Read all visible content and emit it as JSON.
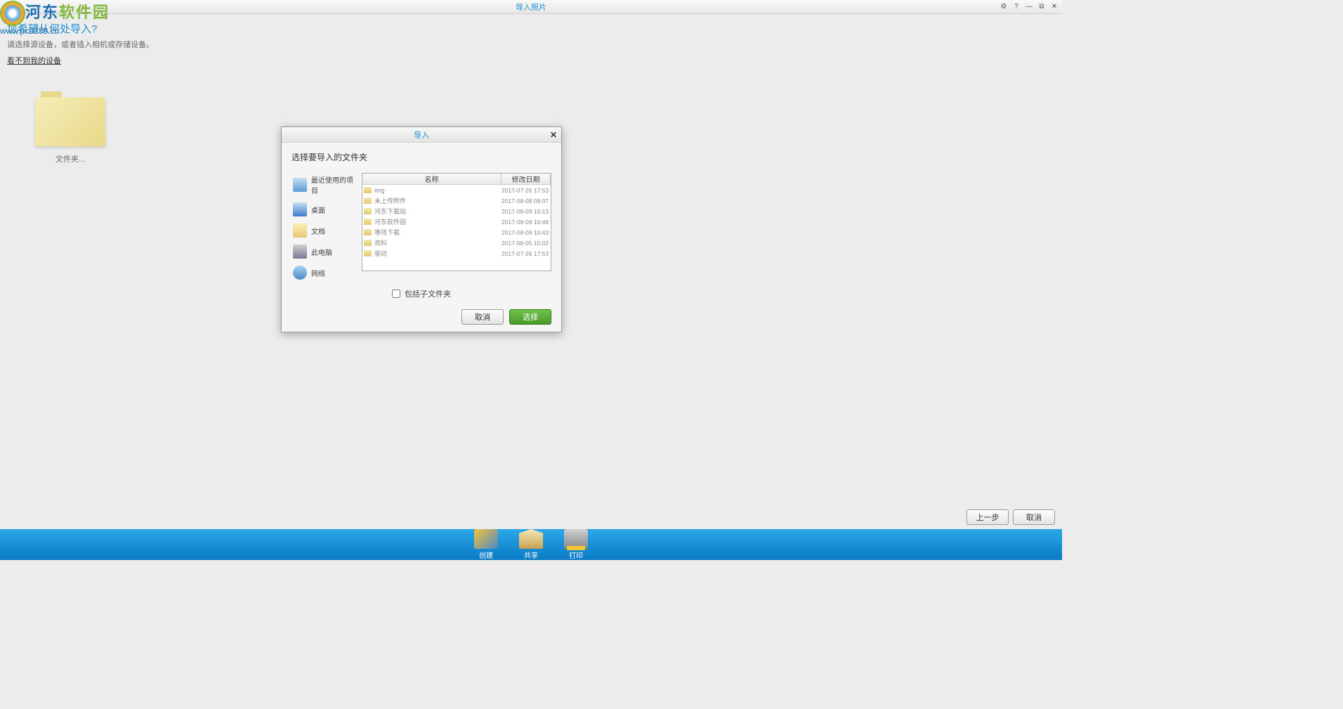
{
  "titlebar": {
    "title": "导入照片",
    "settings_tip": "设置",
    "help_tip": "帮助"
  },
  "watermark": {
    "text_blue": "河东",
    "text_green": "软件园",
    "url": "www.pc0359.cn"
  },
  "main": {
    "prompt_title": "您希望从何处导入?",
    "prompt_sub": "请选择源设备，或者插入相机或存储设备。",
    "prompt_link": "看不到我的设备",
    "folder_label": "文件夹..."
  },
  "dialog": {
    "title": "导入",
    "heading": "选择要导入的文件夹",
    "places": [
      {
        "label": "最近使用的项目",
        "cls": "pi-recent",
        "name": "place-recent"
      },
      {
        "label": "桌面",
        "cls": "pi-desktop",
        "name": "place-desktop"
      },
      {
        "label": "文档",
        "cls": "pi-docs",
        "name": "place-documents"
      },
      {
        "label": "此电脑",
        "cls": "pi-pc",
        "name": "place-thispc"
      },
      {
        "label": "网络",
        "cls": "pi-net",
        "name": "place-network"
      }
    ],
    "cols": {
      "name": "名称",
      "date": "修改日期"
    },
    "rows": [
      {
        "name": "img",
        "date": "2017-07-26 17:53"
      },
      {
        "name": "未上传附件",
        "date": "2017-08-08 08:07"
      },
      {
        "name": "河东下载站",
        "date": "2017-08-09 10:13"
      },
      {
        "name": "河东软件园",
        "date": "2017-08-09 10:48"
      },
      {
        "name": "等待下载",
        "date": "2017-08-09 10:43"
      },
      {
        "name": "资料",
        "date": "2017-08-05 10:02"
      },
      {
        "name": "驱动",
        "date": "2017-07-26 17:53"
      }
    ],
    "include_sub": "包括子文件夹",
    "cancel": "取消",
    "select": "选择"
  },
  "bottom": {
    "prev": "上一步",
    "cancel": "取消"
  },
  "dock": {
    "create": "创建",
    "share": "共享",
    "print": "打印"
  }
}
